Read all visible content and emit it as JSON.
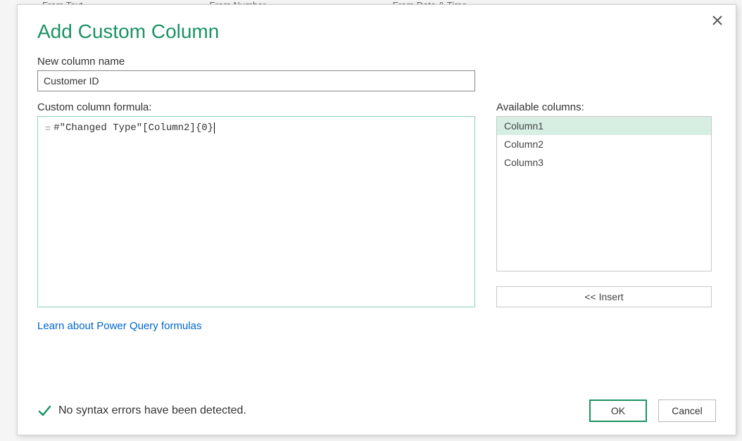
{
  "dialog": {
    "title": "Add Custom Column",
    "newColumnLabel": "New column name",
    "newColumnValue": "Customer ID",
    "formulaLabel": "Custom column formula:",
    "formulaPrefix": "=",
    "formulaValue": "#\"Changed Type\"[Column2]{0}",
    "availableLabel": "Available columns:",
    "columns": [
      "Column1",
      "Column2",
      "Column3"
    ],
    "insertLabel": "<< Insert",
    "learnLink": "Learn about Power Query formulas",
    "statusText": "No syntax errors have been detected.",
    "okLabel": "OK",
    "cancelLabel": "Cancel"
  },
  "background": {
    "ribbonItems": [
      "From Text",
      "From Number",
      "From Date & Time"
    ]
  }
}
